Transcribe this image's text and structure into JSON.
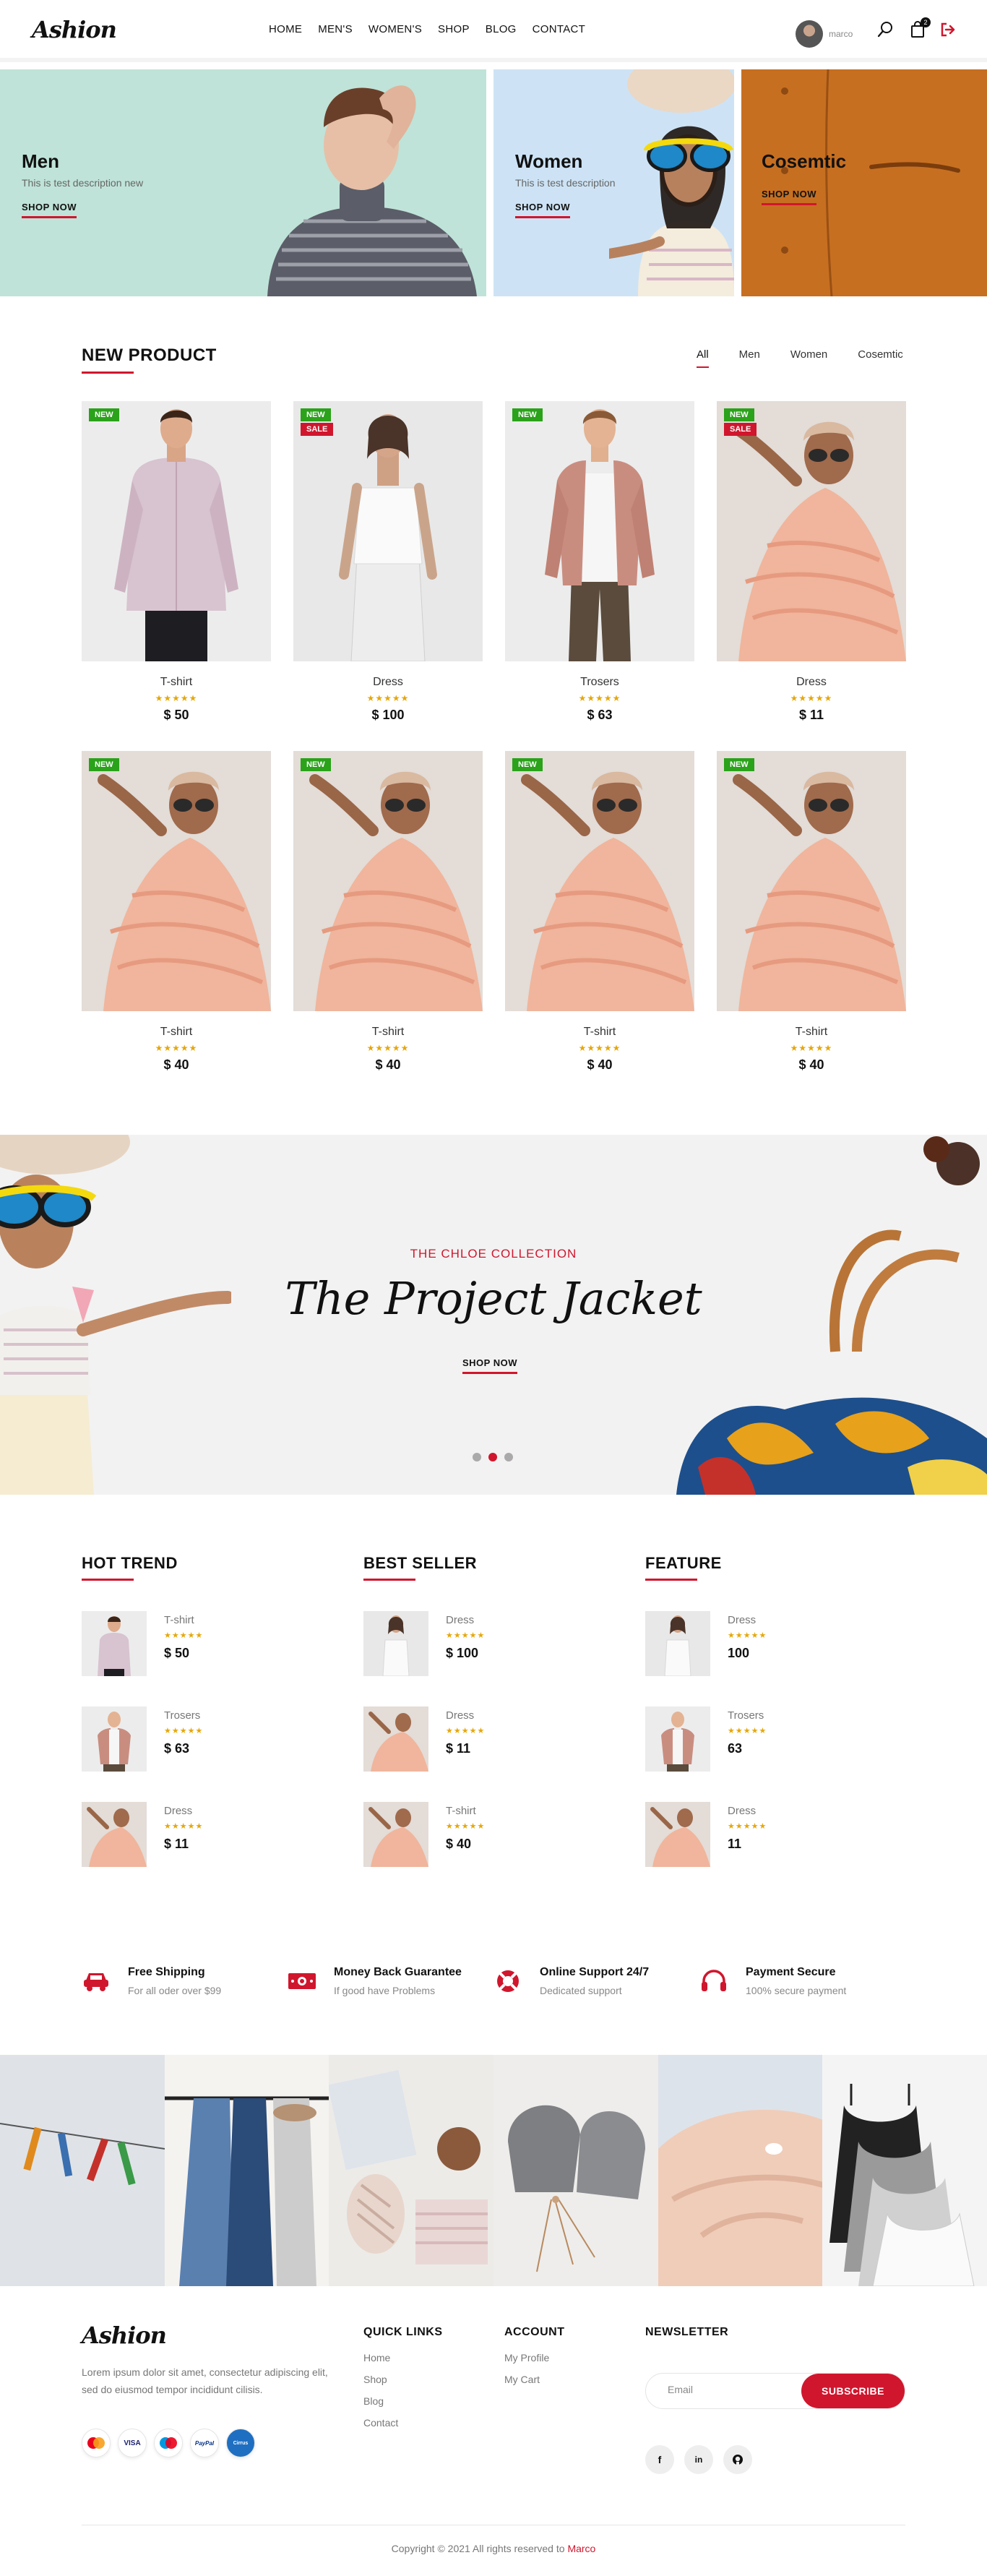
{
  "header": {
    "logo": "Ashion",
    "nav": [
      "HOME",
      "MEN'S",
      "WOMEN'S",
      "SHOP",
      "BLOG",
      "CONTACT"
    ],
    "user_name": "marco",
    "cart_count": "2"
  },
  "hero": {
    "men": {
      "title": "Men",
      "desc": "This is test description new",
      "cta": "SHOP NOW"
    },
    "women": {
      "title": "Women",
      "desc": "This is test description",
      "cta": "SHOP NOW"
    },
    "cosmetic": {
      "title": "Cosemtic",
      "cta": "SHOP NOW"
    }
  },
  "new_product": {
    "title": "NEW PRODUCT",
    "tabs": [
      "All",
      "Men",
      "Women",
      "Cosemtic"
    ],
    "products": [
      {
        "name": "T-shirt",
        "price": "$ 50",
        "stars": "★★★★★",
        "badges": [
          "NEW"
        ]
      },
      {
        "name": "Dress",
        "price": "$ 100",
        "stars": "★★★★★",
        "badges": [
          "NEW",
          "SALE"
        ]
      },
      {
        "name": "Trosers",
        "price": "$ 63",
        "stars": "★★★★★",
        "badges": [
          "NEW"
        ]
      },
      {
        "name": "Dress",
        "price": "$ 11",
        "stars": "★★★★★",
        "badges": [
          "NEW",
          "SALE"
        ]
      },
      {
        "name": "T-shirt",
        "price": "$ 40",
        "stars": "★★★★★",
        "badges": [
          "NEW"
        ]
      },
      {
        "name": "T-shirt",
        "price": "$ 40",
        "stars": "★★★★★",
        "badges": [
          "NEW"
        ]
      },
      {
        "name": "T-shirt",
        "price": "$ 40",
        "stars": "★★★★★",
        "badges": [
          "NEW"
        ]
      },
      {
        "name": "T-shirt",
        "price": "$ 40",
        "stars": "★★★★★",
        "badges": [
          "NEW"
        ]
      }
    ]
  },
  "banner": {
    "subtitle": "THE CHLOE COLLECTION",
    "title": "The Project Jacket",
    "cta": "SHOP NOW"
  },
  "lists": {
    "hot_trend": {
      "title": "HOT TREND",
      "items": [
        {
          "name": "T-shirt",
          "stars": "★★★★★",
          "price": "$ 50"
        },
        {
          "name": "Trosers",
          "stars": "★★★★★",
          "price": "$ 63"
        },
        {
          "name": "Dress",
          "stars": "★★★★★",
          "price": "$ 11"
        }
      ]
    },
    "best_seller": {
      "title": "BEST SELLER",
      "items": [
        {
          "name": "Dress",
          "stars": "★★★★★",
          "price": "$ 100"
        },
        {
          "name": "Dress",
          "stars": "★★★★★",
          "price": "$ 11"
        },
        {
          "name": "T-shirt",
          "stars": "★★★★★",
          "price": "$ 40"
        }
      ]
    },
    "feature": {
      "title": "FEATURE",
      "items": [
        {
          "name": "Dress",
          "stars": "★★★★★",
          "price": "100"
        },
        {
          "name": "Trosers",
          "stars": "★★★★★",
          "price": "63"
        },
        {
          "name": "Dress",
          "stars": "★★★★★",
          "price": "11"
        }
      ]
    }
  },
  "services": [
    {
      "title": "Free Shipping",
      "sub": "For all oder over $99",
      "icon": "car-icon"
    },
    {
      "title": "Money Back Guarantee",
      "sub": "If good have Problems",
      "icon": "money-icon"
    },
    {
      "title": "Online Support 24/7",
      "sub": "Dedicated support",
      "icon": "lifebuoy-icon"
    },
    {
      "title": "Payment Secure",
      "sub": "100% secure payment",
      "icon": "headphones-icon"
    }
  ],
  "footer": {
    "logo": "Ashion",
    "about": "Lorem ipsum dolor sit amet, consectetur adipiscing elit, sed do eiusmod tempor incididunt cilisis.",
    "payments": [
      "MasterCard",
      "VISA",
      "Maestro",
      "PayPal",
      "Cirrus"
    ],
    "quick_links": {
      "title": "QUICK LINKS",
      "links": [
        "Home",
        "Shop",
        "Blog",
        "Contact"
      ]
    },
    "account": {
      "title": "ACCOUNT",
      "links": [
        "My Profile",
        "My Cart"
      ]
    },
    "newsletter": {
      "title": "NEWSLETTER",
      "placeholder": "Email",
      "button": "SUBSCRIBE"
    },
    "socials": [
      "f",
      "in",
      "gh"
    ],
    "copyright": "Copyright © 2021 All rights reserved to",
    "author": "Marco"
  },
  "colors": {
    "accent": "#d0162d",
    "star": "#e5a70b",
    "new_badge": "#2aa21a"
  }
}
